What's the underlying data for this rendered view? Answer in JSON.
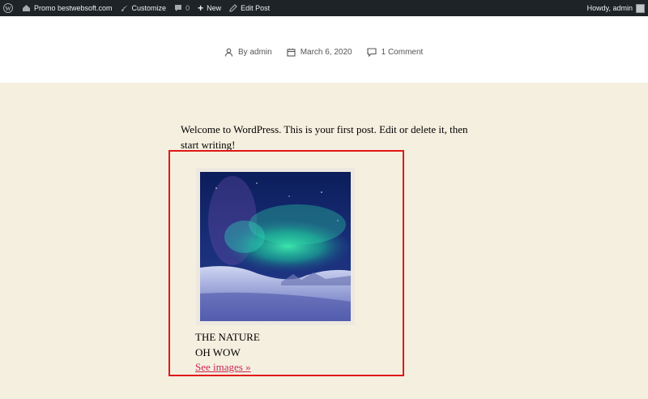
{
  "adminbar": {
    "site_name": "Promo bestwebsoft.com",
    "customize": "Customize",
    "comments_count": "0",
    "new": "New",
    "edit_post": "Edit Post",
    "howdy": "Howdy, admin"
  },
  "post_meta": {
    "author": "By admin",
    "date": "March 6, 2020",
    "comments": "1 Comment"
  },
  "content": {
    "intro": "Welcome to WordPress. This is your first post. Edit or delete it, then start writing!"
  },
  "gallery": {
    "caption_line1": "THE NATURE",
    "caption_line2": "OH WOW",
    "link": "See images »"
  },
  "colors": {
    "adminbar_bg": "#1d2327",
    "page_bg": "#f5efe0",
    "accent": "#cd2653",
    "highlight_border": "#e01818"
  }
}
